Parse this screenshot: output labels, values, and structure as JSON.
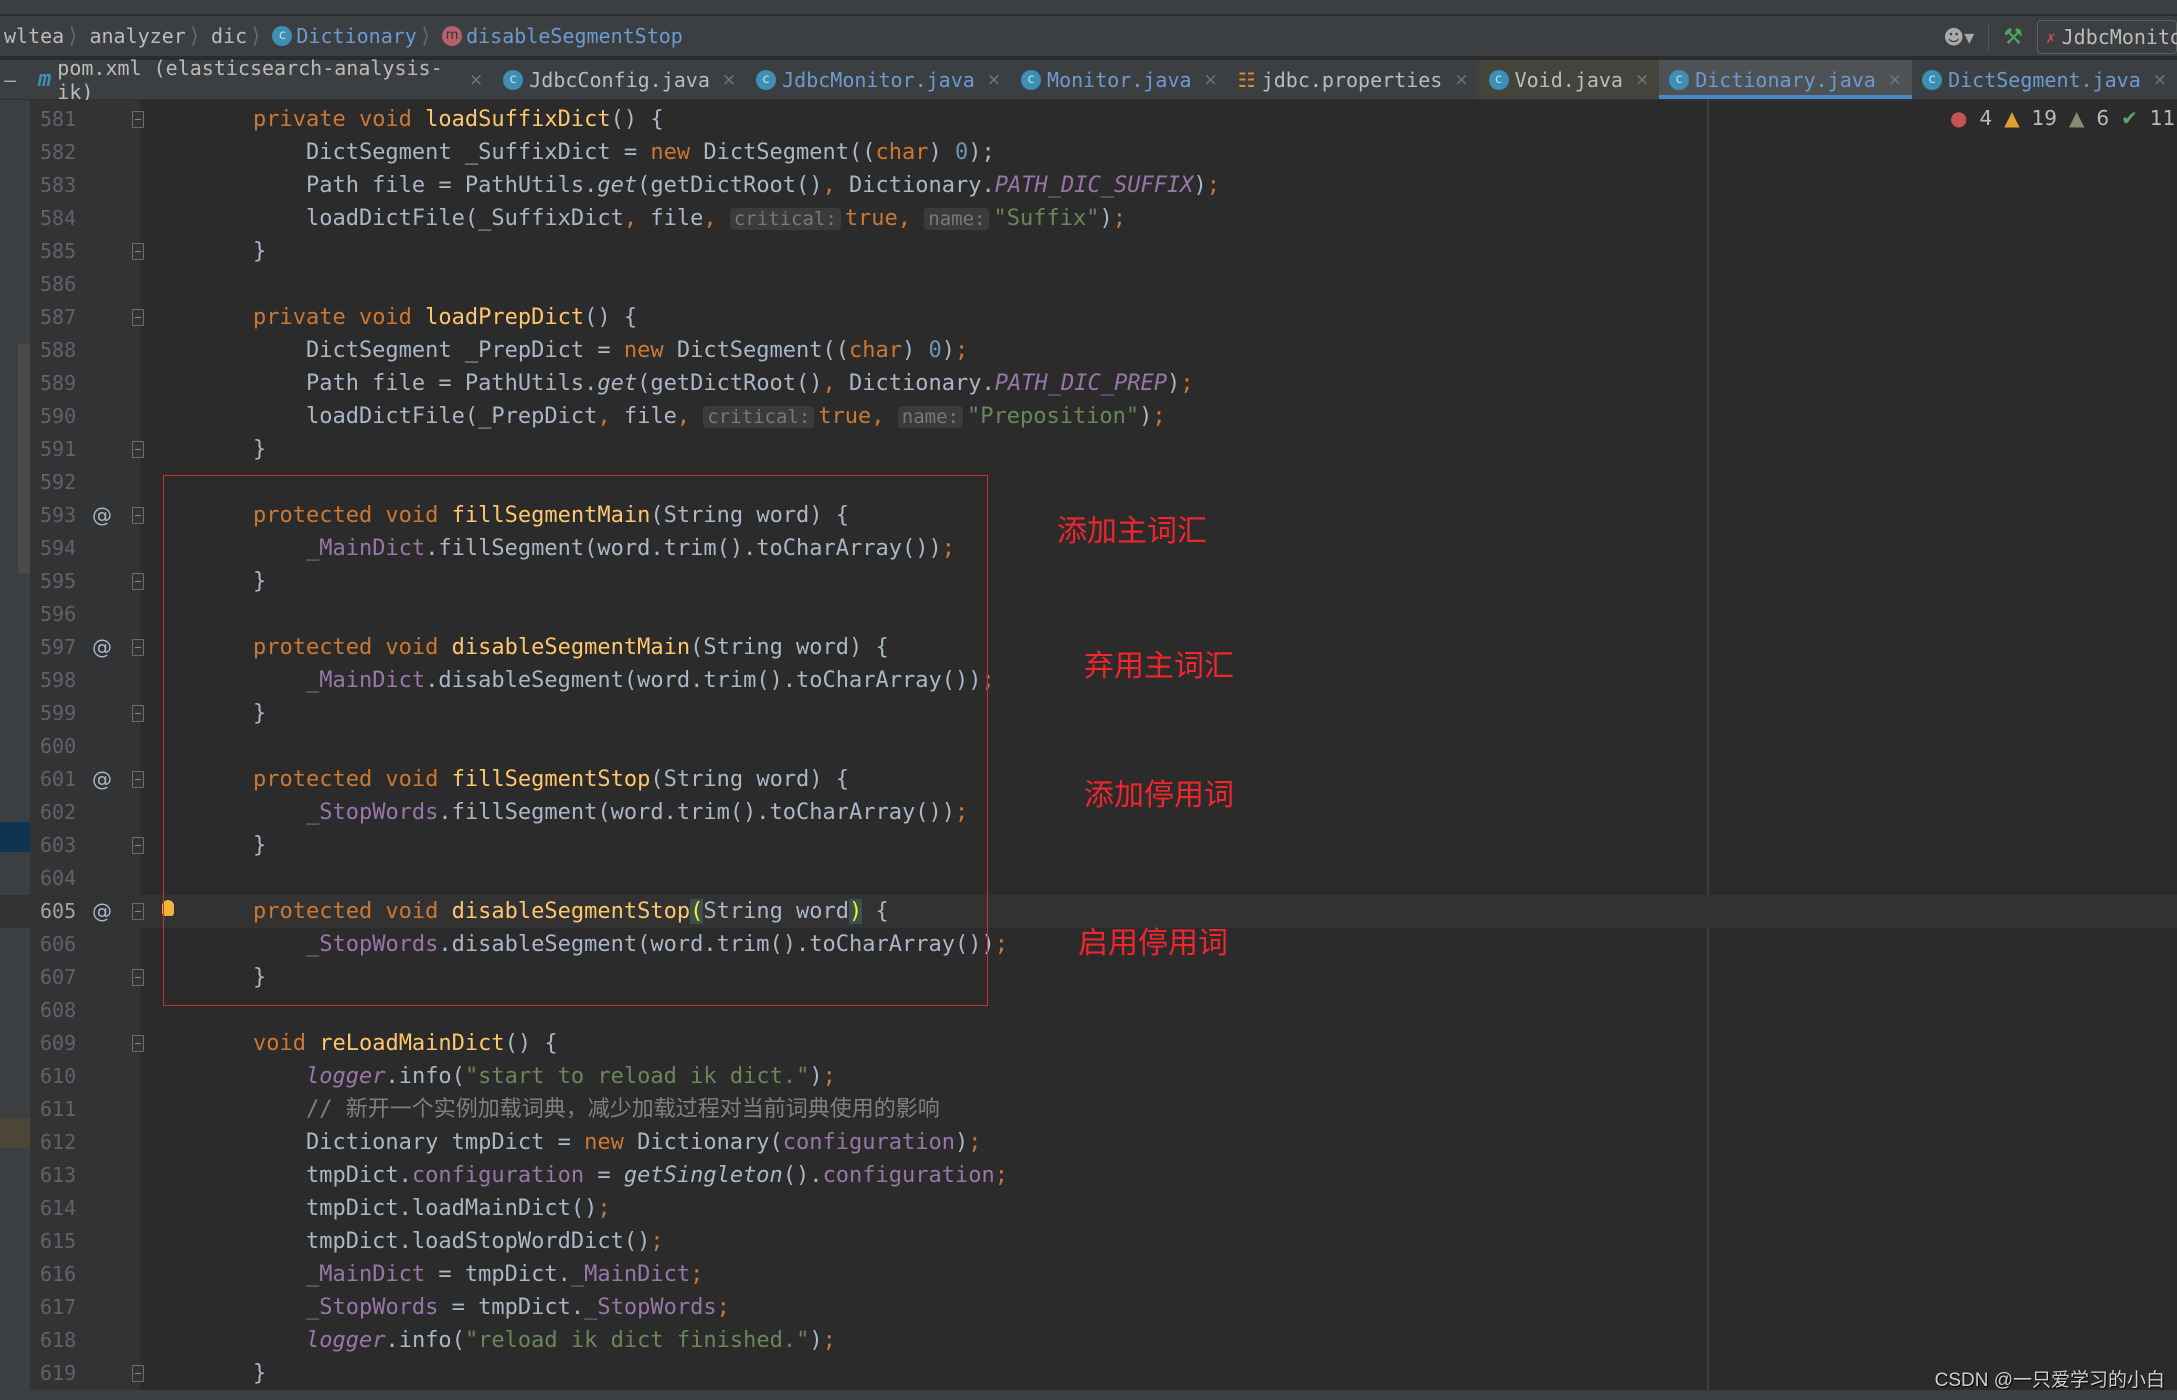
{
  "breadcrumb": [
    {
      "label": "wltea",
      "icon": null
    },
    {
      "label": "analyzer",
      "icon": null
    },
    {
      "label": "dic",
      "icon": null
    },
    {
      "label": "Dictionary",
      "icon": "class-icon"
    },
    {
      "label": "disableSegmentStop",
      "icon": "method-icon"
    }
  ],
  "toolbar": {
    "run_config": "JdbcMonitor"
  },
  "tabs": [
    {
      "label": "pom.xml (elasticsearch-analysis-ik)",
      "icon": "maven-icon",
      "state": ""
    },
    {
      "label": "JdbcConfig.java",
      "icon": "class-icon",
      "state": ""
    },
    {
      "label": "JdbcMonitor.java",
      "icon": "class-icon",
      "state": "blue"
    },
    {
      "label": "Monitor.java",
      "icon": "class-icon",
      "state": "blue"
    },
    {
      "label": "jdbc.properties",
      "icon": "properties-icon",
      "state": ""
    },
    {
      "label": "Void.java",
      "icon": "class-icon",
      "state": "void"
    },
    {
      "label": "Dictionary.java",
      "icon": "class-icon",
      "state": "active"
    },
    {
      "label": "DictSegment.java",
      "icon": "class-icon",
      "state": "blue"
    }
  ],
  "inspections": {
    "errors": "4",
    "warnings": "19",
    "weak_warnings": "6",
    "typos": "11"
  },
  "current_line": 605,
  "lines": [
    {
      "n": 581,
      "fold": "open",
      "tokens": [
        [
          "    ",
          ""
        ],
        [
          "private void ",
          "kw"
        ],
        [
          "loadSuffixDict",
          "fn"
        ],
        [
          "() {",
          ""
        ]
      ]
    },
    {
      "n": 582,
      "tokens": [
        [
          "        DictSegment _SuffixDict = ",
          ""
        ],
        [
          "new ",
          "kw"
        ],
        [
          "DictSegment((",
          ""
        ],
        [
          "char",
          "kw"
        ],
        [
          ") ",
          ""
        ],
        [
          "0",
          "num"
        ],
        [
          ");",
          ""
        ]
      ]
    },
    {
      "n": 583,
      "tokens": [
        [
          "        Path file = PathUtils.",
          ""
        ],
        [
          "get",
          "it"
        ],
        [
          "(getDictRoot()",
          ""
        ],
        [
          ", ",
          "punc"
        ],
        [
          "Dictionary.",
          ""
        ],
        [
          "PATH_DIC_SUFFIX",
          "sfld"
        ],
        [
          ")",
          ""
        ],
        [
          ";",
          "punc"
        ]
      ]
    },
    {
      "n": 584,
      "tokens": [
        [
          "        loadDictFile(_SuffixDict",
          ""
        ],
        [
          ", ",
          "punc"
        ],
        [
          "file",
          ""
        ],
        [
          ", ",
          "punc"
        ],
        [
          "critical:",
          "hint"
        ],
        [
          "true",
          "kw"
        ],
        [
          ", ",
          "punc"
        ],
        [
          "name:",
          "hint"
        ],
        [
          "\"Suffix\"",
          "str"
        ],
        [
          ")",
          ""
        ],
        [
          ";",
          "punc"
        ]
      ]
    },
    {
      "n": 585,
      "fold": "close",
      "tokens": [
        [
          "    }",
          ""
        ]
      ]
    },
    {
      "n": 586,
      "tokens": []
    },
    {
      "n": 587,
      "fold": "open",
      "tokens": [
        [
          "    ",
          ""
        ],
        [
          "private void ",
          "kw"
        ],
        [
          "loadPrepDict",
          "fn"
        ],
        [
          "() {",
          ""
        ]
      ]
    },
    {
      "n": 588,
      "tokens": [
        [
          "        DictSegment _PrepDict = ",
          ""
        ],
        [
          "new ",
          "kw"
        ],
        [
          "DictSegment((",
          ""
        ],
        [
          "char",
          "kw"
        ],
        [
          ") ",
          ""
        ],
        [
          "0",
          "num"
        ],
        [
          ")",
          ""
        ],
        [
          ";",
          "punc"
        ]
      ]
    },
    {
      "n": 589,
      "tokens": [
        [
          "        Path file = PathUtils.",
          ""
        ],
        [
          "get",
          "it"
        ],
        [
          "(getDictRoot()",
          ""
        ],
        [
          ", ",
          "punc"
        ],
        [
          "Dictionary.",
          ""
        ],
        [
          "PATH_DIC_PREP",
          "sfld"
        ],
        [
          ")",
          ""
        ],
        [
          ";",
          "punc"
        ]
      ]
    },
    {
      "n": 590,
      "tokens": [
        [
          "        loadDictFile(_PrepDict",
          ""
        ],
        [
          ", ",
          "punc"
        ],
        [
          "file",
          ""
        ],
        [
          ", ",
          "punc"
        ],
        [
          "critical:",
          "hint"
        ],
        [
          "true",
          "kw"
        ],
        [
          ", ",
          "punc"
        ],
        [
          "name:",
          "hint"
        ],
        [
          "\"Preposition\"",
          "str"
        ],
        [
          ")",
          ""
        ],
        [
          ";",
          "punc"
        ]
      ]
    },
    {
      "n": 591,
      "fold": "close",
      "tokens": [
        [
          "    }",
          ""
        ]
      ]
    },
    {
      "n": 592,
      "tokens": []
    },
    {
      "n": 593,
      "at": true,
      "fold": "open",
      "tokens": [
        [
          "    ",
          ""
        ],
        [
          "protected void ",
          "kw"
        ],
        [
          "fillSegmentMain",
          "fn"
        ],
        [
          "(String word) {",
          ""
        ]
      ]
    },
    {
      "n": 594,
      "tokens": [
        [
          "        ",
          ""
        ],
        [
          "_MainDict",
          "fld"
        ],
        [
          ".fillSegment(word.trim().toCharArray())",
          ""
        ],
        [
          ";",
          "punc"
        ]
      ]
    },
    {
      "n": 595,
      "fold": "close",
      "tokens": [
        [
          "    }",
          ""
        ]
      ]
    },
    {
      "n": 596,
      "tokens": []
    },
    {
      "n": 597,
      "at": true,
      "fold": "open",
      "tokens": [
        [
          "    ",
          ""
        ],
        [
          "protected void ",
          "kw"
        ],
        [
          "disableSegmentMain",
          "fn"
        ],
        [
          "(String word) {",
          ""
        ]
      ]
    },
    {
      "n": 598,
      "tokens": [
        [
          "        ",
          ""
        ],
        [
          "_MainDict",
          "fld"
        ],
        [
          ".disableSegment(word.trim().toCharArray())",
          ""
        ],
        [
          ";",
          "punc"
        ]
      ]
    },
    {
      "n": 599,
      "fold": "close",
      "tokens": [
        [
          "    }",
          ""
        ]
      ]
    },
    {
      "n": 600,
      "tokens": []
    },
    {
      "n": 601,
      "at": true,
      "fold": "open",
      "tokens": [
        [
          "    ",
          ""
        ],
        [
          "protected void ",
          "kw"
        ],
        [
          "fillSegmentStop",
          "fn"
        ],
        [
          "(String word) {",
          ""
        ]
      ]
    },
    {
      "n": 602,
      "tokens": [
        [
          "        ",
          ""
        ],
        [
          "_StopWords",
          "fld"
        ],
        [
          ".fillSegment(word.trim().toCharArray())",
          ""
        ],
        [
          ";",
          "punc"
        ]
      ]
    },
    {
      "n": 603,
      "fold": "close",
      "tokens": [
        [
          "    }",
          ""
        ]
      ]
    },
    {
      "n": 604,
      "tokens": []
    },
    {
      "n": 605,
      "at": true,
      "fold": "open",
      "bulb": true,
      "tokens": [
        [
          "    ",
          ""
        ],
        [
          "protected void ",
          "kw"
        ],
        [
          "disableSegmentStop",
          "fn"
        ],
        [
          "(",
          "brm"
        ],
        [
          "String word",
          ""
        ],
        [
          ")",
          "brm"
        ],
        [
          " {",
          ""
        ]
      ]
    },
    {
      "n": 606,
      "tokens": [
        [
          "        ",
          ""
        ],
        [
          "_StopWords",
          "fld"
        ],
        [
          ".disableSegment(word.trim().toCharArray())",
          ""
        ],
        [
          ";",
          "punc"
        ]
      ]
    },
    {
      "n": 607,
      "fold": "close",
      "tokens": [
        [
          "    }",
          ""
        ]
      ]
    },
    {
      "n": 608,
      "tokens": []
    },
    {
      "n": 609,
      "fold": "open",
      "tokens": [
        [
          "    ",
          ""
        ],
        [
          "void ",
          "kw"
        ],
        [
          "reLoadMainDict",
          "fn"
        ],
        [
          "() {",
          ""
        ]
      ]
    },
    {
      "n": 610,
      "tokens": [
        [
          "        ",
          ""
        ],
        [
          "logger",
          "sfld"
        ],
        [
          ".info(",
          ""
        ],
        [
          "\"start to reload ik dict.\"",
          "str"
        ],
        [
          ")",
          ""
        ],
        [
          ";",
          "punc"
        ]
      ]
    },
    {
      "n": 611,
      "tokens": [
        [
          "        ",
          ""
        ],
        [
          "// 新开一个实例加载词典，减少加载过程对当前词典使用的影响",
          "cmt"
        ]
      ]
    },
    {
      "n": 612,
      "tokens": [
        [
          "        Dictionary tmpDict = ",
          ""
        ],
        [
          "new ",
          "kw"
        ],
        [
          "Dictionary(",
          ""
        ],
        [
          "configuration",
          "fld"
        ],
        [
          ")",
          ""
        ],
        [
          ";",
          "punc"
        ]
      ]
    },
    {
      "n": 613,
      "tokens": [
        [
          "        tmpDict.",
          ""
        ],
        [
          "configuration",
          "fld"
        ],
        [
          " = ",
          ""
        ],
        [
          "getSingleton",
          "it"
        ],
        [
          "().",
          ""
        ],
        [
          "configuration",
          "fld"
        ],
        [
          ";",
          "punc"
        ]
      ]
    },
    {
      "n": 614,
      "tokens": [
        [
          "        tmpDict.loadMainDict()",
          ""
        ],
        [
          ";",
          "punc"
        ]
      ]
    },
    {
      "n": 615,
      "tokens": [
        [
          "        tmpDict.loadStopWordDict()",
          ""
        ],
        [
          ";",
          "punc"
        ]
      ]
    },
    {
      "n": 616,
      "tokens": [
        [
          "        ",
          ""
        ],
        [
          "_MainDict",
          "fld"
        ],
        [
          " = tmpDict.",
          ""
        ],
        [
          "_MainDict",
          "fld"
        ],
        [
          ";",
          "punc"
        ]
      ]
    },
    {
      "n": 617,
      "tokens": [
        [
          "        ",
          ""
        ],
        [
          "_StopWords",
          "fld"
        ],
        [
          " = tmpDict.",
          ""
        ],
        [
          "_StopWords",
          "fld"
        ],
        [
          ";",
          "punc"
        ]
      ]
    },
    {
      "n": 618,
      "tokens": [
        [
          "        ",
          ""
        ],
        [
          "logger",
          "sfld"
        ],
        [
          ".info(",
          ""
        ],
        [
          "\"reload ik dict finished.\"",
          "str"
        ],
        [
          ")",
          ""
        ],
        [
          ";",
          "punc"
        ]
      ]
    },
    {
      "n": 619,
      "fold": "close",
      "tokens": [
        [
          "    }",
          ""
        ]
      ]
    }
  ],
  "annotations": {
    "box_color": "#d22b30",
    "notes": [
      "添加主词汇",
      "弃用主词汇",
      "添加停用词",
      "启用停用词"
    ]
  },
  "watermark": "CSDN @一只爱学习的小白"
}
